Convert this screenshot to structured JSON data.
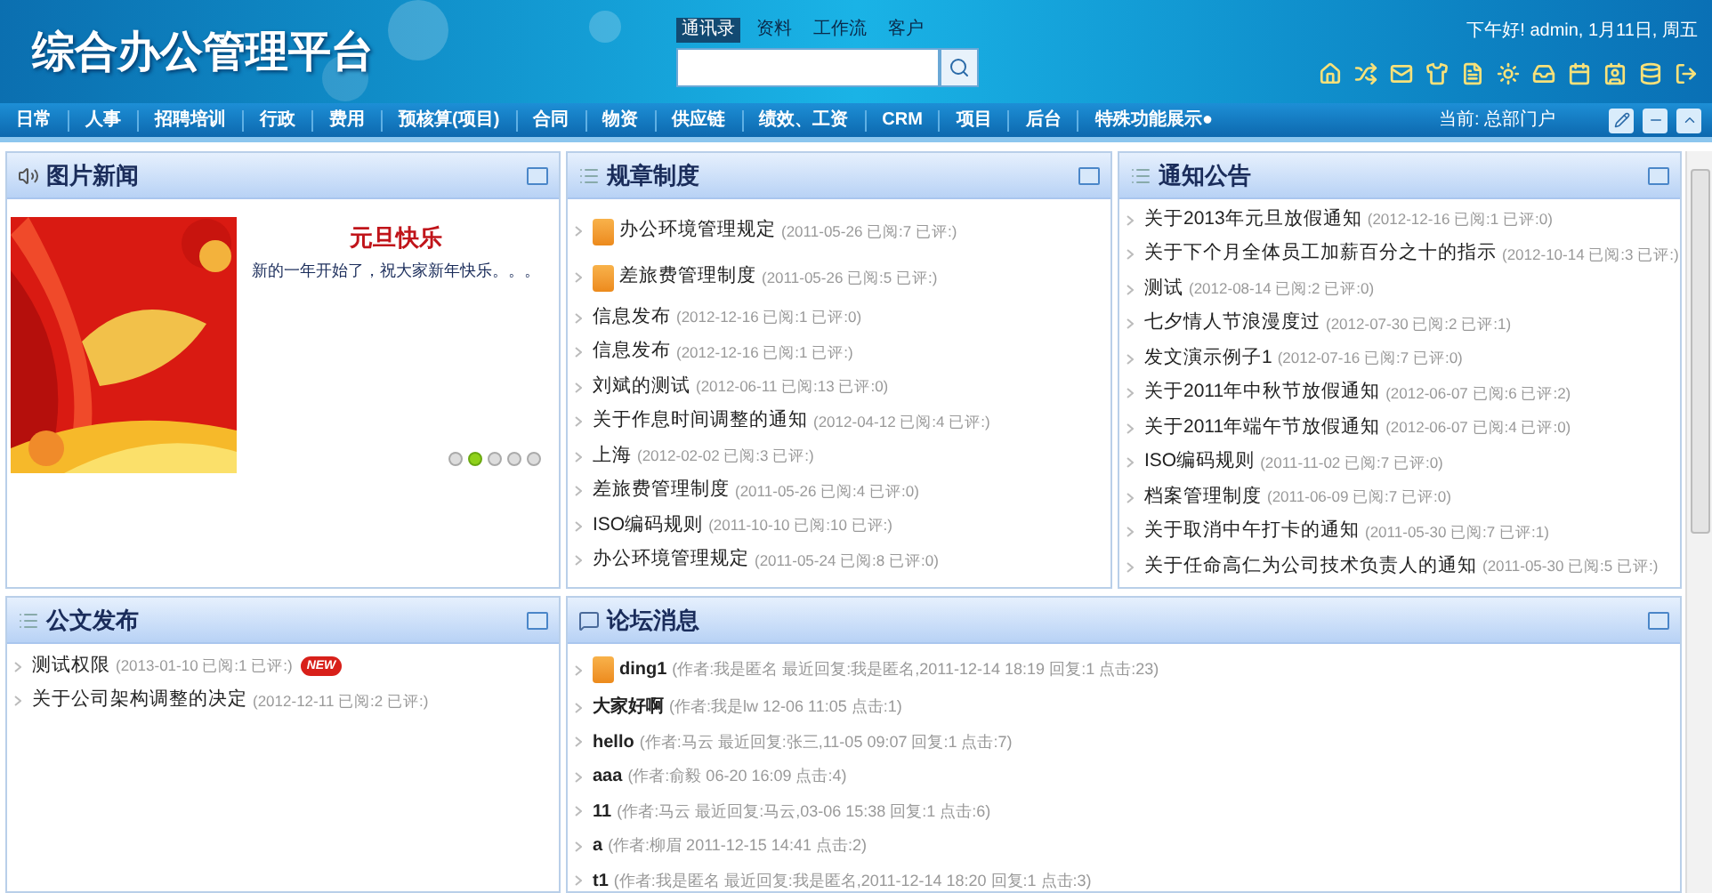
{
  "header": {
    "logo": "综合办公管理平台",
    "search_tabs": [
      {
        "label": "通讯录",
        "selected": true
      },
      {
        "label": "资料",
        "selected": false
      },
      {
        "label": "工作流",
        "selected": false
      },
      {
        "label": "客户",
        "selected": false
      }
    ],
    "greeting": "下午好! admin, 1月11日, 周五"
  },
  "nav": {
    "items": [
      "日常",
      "人事",
      "招聘培训",
      "行政",
      "费用",
      "预核算(项目)",
      "合同",
      "物资",
      "供应链",
      "绩效、工资",
      "CRM",
      "项目",
      "后台",
      "特殊功能展示●"
    ],
    "current": "当前: 总部门户"
  },
  "picture_news": {
    "title": "图片新闻",
    "headline": "元旦快乐",
    "summary": "新的一年开始了，祝大家新年快乐。。。",
    "dots": [
      {
        "selected": false
      },
      {
        "selected": true
      },
      {
        "selected": false
      },
      {
        "selected": false
      },
      {
        "selected": false
      }
    ]
  },
  "rules": {
    "title": "规章制度",
    "items": [
      {
        "title": "办公环境管理规定",
        "meta": "(2011-05-26 已阅:7 已评:)",
        "pinned": true
      },
      {
        "title": "差旅费管理制度",
        "meta": "(2011-05-26 已阅:5 已评:)",
        "pinned": true
      },
      {
        "title": "信息发布",
        "meta": "(2012-12-16 已阅:1 已评:0)",
        "pinned": false
      },
      {
        "title": "信息发布",
        "meta": "(2012-12-16 已阅:1 已评:)",
        "pinned": false
      },
      {
        "title": "刘斌的测试",
        "meta": "(2012-06-11 已阅:13 已评:0)",
        "pinned": false
      },
      {
        "title": "关于作息时间调整的通知",
        "meta": "(2012-04-12 已阅:4 已评:)",
        "pinned": false
      },
      {
        "title": "上海",
        "meta": "(2012-02-02 已阅:3 已评:)",
        "pinned": false
      },
      {
        "title": "差旅费管理制度",
        "meta": "(2011-05-26 已阅:4 已评:0)",
        "pinned": false
      },
      {
        "title": "ISO编码规则",
        "meta": "(2011-10-10 已阅:10 已评:)",
        "pinned": false
      },
      {
        "title": "办公环境管理规定",
        "meta": "(2011-05-24 已阅:8 已评:0)",
        "pinned": false
      }
    ]
  },
  "notices": {
    "title": "通知公告",
    "items": [
      {
        "title": "关于2013年元旦放假通知",
        "meta": "(2012-12-16 已阅:1 已评:0)"
      },
      {
        "title": "关于下个月全体员工加薪百分之十的指示",
        "meta": "(2012-10-14 已阅:3 已评:)"
      },
      {
        "title": "测试",
        "meta": "(2012-08-14 已阅:2 已评:0)"
      },
      {
        "title": "七夕情人节浪漫度过",
        "meta": "(2012-07-30 已阅:2 已评:1)"
      },
      {
        "title": "发文演示例子1",
        "meta": "(2012-07-16 已阅:7 已评:0)"
      },
      {
        "title": "关于2011年中秋节放假通知",
        "meta": "(2012-06-07 已阅:6 已评:2)"
      },
      {
        "title": "关于2011年端午节放假通知",
        "meta": "(2012-06-07 已阅:4 已评:0)"
      },
      {
        "title": "ISO编码规则",
        "meta": "(2011-11-02 已阅:7 已评:0)"
      },
      {
        "title": "档案管理制度",
        "meta": "(2011-06-09 已阅:7 已评:0)"
      },
      {
        "title": "关于取消中午打卡的通知",
        "meta": "(2011-05-30 已阅:7 已评:1)"
      },
      {
        "title": "关于任命高仁为公司技术负责人的通知",
        "meta": "(2011-05-30 已阅:5 已评:)"
      }
    ]
  },
  "documents": {
    "title": "公文发布",
    "items": [
      {
        "title": "测试权限",
        "meta": "(2013-01-10 已阅:1 已评:)",
        "badge": "NEW"
      },
      {
        "title": "关于公司架构调整的决定",
        "meta": "(2012-12-11 已阅:2 已评:)"
      }
    ]
  },
  "forum": {
    "title": "论坛消息",
    "items": [
      {
        "title": "ding1",
        "meta": "(作者:我是匿名 最近回复:我是匿名,2011-12-14 18:19 回复:1 点击:23)",
        "pinned": true
      },
      {
        "title": "大家好啊",
        "meta": "(作者:我是lw 12-06 11:05 点击:1)",
        "pinned": false
      },
      {
        "title": "hello",
        "meta": "(作者:马云 最近回复:张三,11-05 09:07 回复:1 点击:7)",
        "pinned": false
      },
      {
        "title": "aaa",
        "meta": "(作者:俞毅 06-20 16:09 点击:4)",
        "pinned": false
      },
      {
        "title": "11",
        "meta": "(作者:马云 最近回复:马云,03-06 15:38 回复:1 点击:6)",
        "pinned": false
      },
      {
        "title": "a",
        "meta": "(作者:柳眉 2011-12-15 14:41 点击:2)",
        "pinned": false
      },
      {
        "title": "t1",
        "meta": "(作者:我是匿名 最近回复:我是匿名,2011-12-14 18:20 回复:1 点击:3)",
        "pinned": false
      }
    ]
  }
}
